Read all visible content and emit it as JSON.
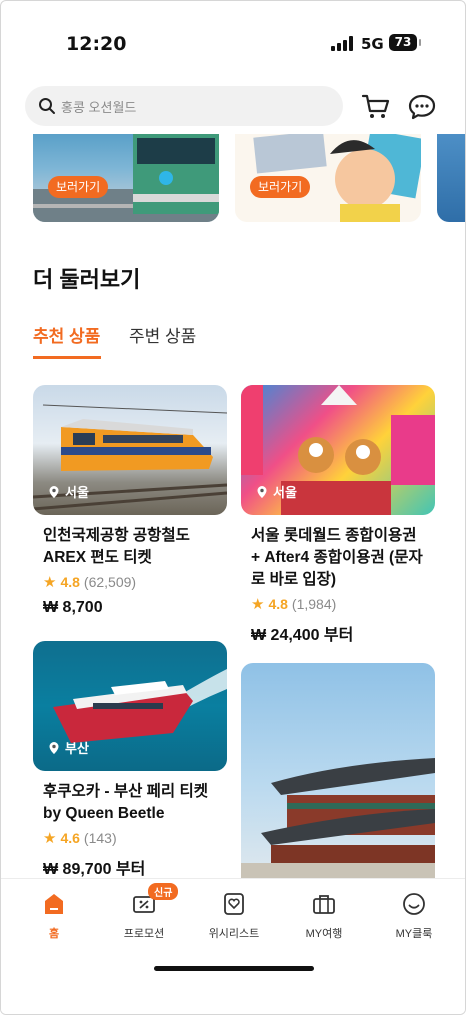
{
  "status_bar": {
    "time": "12:20",
    "network": "5G",
    "battery": "73"
  },
  "header": {
    "search_placeholder": "홍콩 오션월드"
  },
  "banners": [
    {
      "button_label": "보러가기"
    },
    {
      "button_label": "보러가기"
    }
  ],
  "section": {
    "title": "더 둘러보기",
    "tabs": [
      {
        "label": "추천 상품",
        "active": true
      },
      {
        "label": "주변 상품",
        "active": false
      }
    ]
  },
  "products": [
    {
      "location": "서울",
      "title": "인천국제공항 공항철도 AREX 편도 티켓",
      "rating": "4.8",
      "reviews": "(62,509)",
      "price": "₩ 8,700"
    },
    {
      "location": "서울",
      "title": "서울 롯데월드 종합이용권 + After4 종합이용권 (문자로 바로 입장)",
      "rating": "4.8",
      "reviews": "(1,984)",
      "price": "₩ 24,400 부터"
    },
    {
      "location": "부산",
      "title": "후쿠오카 - 부산 페리 티켓 by Queen Beetle",
      "rating": "4.6",
      "reviews": "(143)",
      "price": "₩ 89,700 부터"
    },
    {
      "location": "",
      "title": "",
      "rating": "",
      "reviews": "",
      "price": ""
    }
  ],
  "bottom_nav": [
    {
      "label": "홈",
      "icon": "home-icon",
      "active": true
    },
    {
      "label": "프로모션",
      "icon": "coupon-icon",
      "badge": "신규"
    },
    {
      "label": "위시리스트",
      "icon": "wishlist-icon"
    },
    {
      "label": "MY여행",
      "icon": "suitcase-icon"
    },
    {
      "label": "MY클룩",
      "icon": "smile-icon"
    }
  ],
  "colors": {
    "accent": "#f26b21",
    "star": "#f5a524"
  }
}
